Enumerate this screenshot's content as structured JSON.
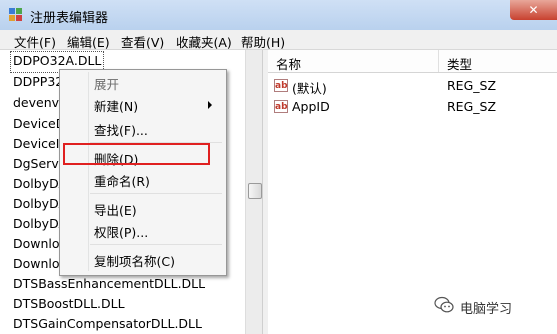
{
  "window": {
    "title": "注册表编辑器",
    "close_label": "✕"
  },
  "menubar": [
    "文件(F)",
    "编辑(E)",
    "查看(V)",
    "收藏夹(A)",
    "帮助(H)"
  ],
  "tree": {
    "items": [
      "DDPO32A.DLL",
      "DDPP32",
      "devenv.e",
      "DeviceD",
      "DeviceIc",
      "DgServi",
      "DolbyDA",
      "DolbyDA",
      "DolbyDA",
      "Downlo",
      "Downlo",
      "DTSBassEnhancementDLL.DLL",
      "DTSBoostDLL.DLL",
      "DTSGainCompensatorDLL.DLL"
    ]
  },
  "list": {
    "columns": {
      "name": "名称",
      "type": "类型"
    },
    "rows": [
      {
        "name": "(默认)",
        "type": "REG_SZ",
        "icon": "string-value-icon"
      },
      {
        "name": "AppID",
        "type": "REG_SZ",
        "icon": "string-value-icon"
      }
    ]
  },
  "context_menu": {
    "expand": "展开",
    "new": "新建(N)",
    "find": "查找(F)...",
    "delete": "删除(D)",
    "rename": "重命名(R)",
    "export": "导出(E)",
    "permissions": "权限(P)...",
    "copy_key_name": "复制项名称(C)"
  },
  "watermark": "电脑学习",
  "colors": {
    "highlight": "#e02020"
  }
}
